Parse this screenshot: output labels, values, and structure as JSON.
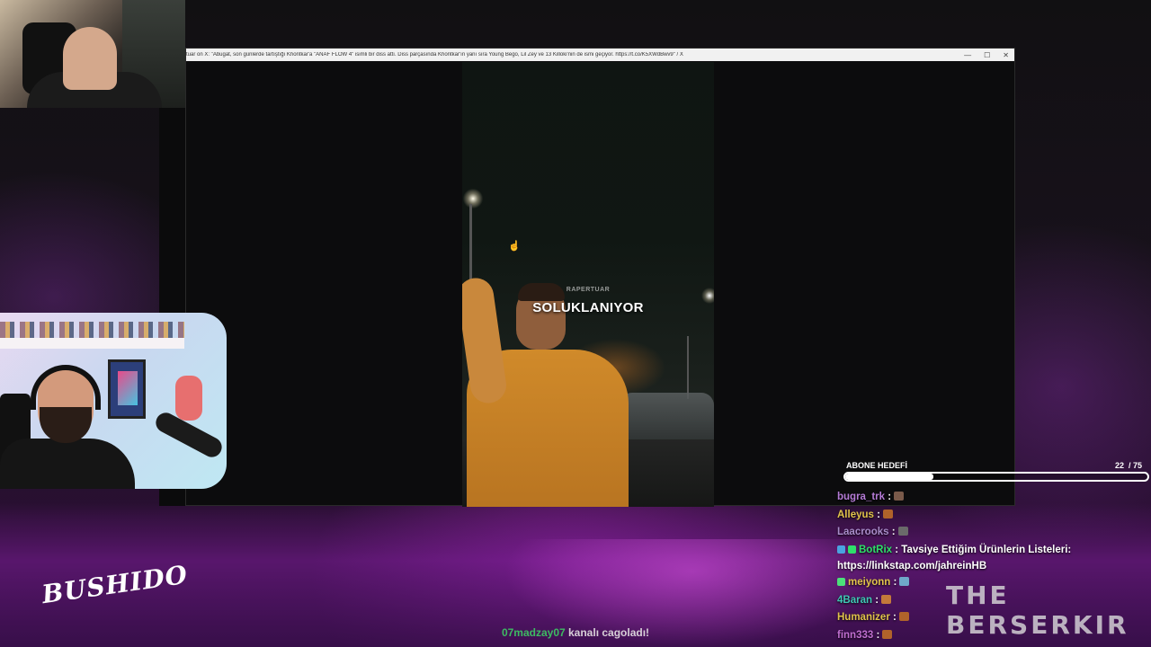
{
  "window": {
    "title": "tuar on X: \"Abugat, son günlerde tartıştığı Khontkar'a \"ANAF FLOW 4\" isimli bir diss attı. Diss parçasında Khontkar'ın yanı sıra Young Bego, Lil Zey ve 13 Killoki'nin de ismi geçiyor. https://t.co/K5XWdBwv9\" / X",
    "minimize": "—",
    "maximize": "☐",
    "close": "✕"
  },
  "video": {
    "watermark": "RAPERTUAR",
    "caption": "SOLUKLANIYOR"
  },
  "logos": {
    "left": "BUSHIDO",
    "right": "THE BERSERKIR"
  },
  "sub_goal": {
    "label": "ABONE HEDEFİ",
    "current": "22",
    "total": "/ 75",
    "progress": 0.293
  },
  "chat": {
    "messages": [
      {
        "user": "bugra_trk",
        "color": "#b57bd6",
        "sep": " :",
        "text": "",
        "emote_color": "#7a5a4a"
      },
      {
        "user": "Alleyus",
        "color": "#e0c34a",
        "sep": " :",
        "text": "",
        "emote_color": "#b0632a"
      },
      {
        "user": "Laacrooks",
        "color": "#a88cc9",
        "sep": " :",
        "text": "",
        "emote_color": "#6a6a6a"
      },
      {
        "user": "BotRix",
        "color": "#2ee06a",
        "sep": " :",
        "text": " Tavsiye Ettiğim Ürünlerin Listeleri:",
        "emote_color": ""
      },
      {
        "user": "meiyonn",
        "color": "#e0c34a",
        "sep": " :",
        "text": "",
        "emote_color": "#6fa8c9"
      },
      {
        "user": "4Baran",
        "color": "#3fc7b5",
        "sep": " :",
        "text": "",
        "emote_color": "#c47a3a"
      },
      {
        "user": "Humanizer",
        "color": "#e0c34a",
        "sep": " :",
        "text": "",
        "emote_color": "#b0632a"
      },
      {
        "user": "finn333",
        "color": "#c06fd0",
        "sep": " :",
        "text": "",
        "emote_color": "#b0632a"
      }
    ],
    "link": "https://linkstap.com/jahreinHB"
  },
  "notification": {
    "nick": "07madzay07",
    "text": " kanalı cagoladı!"
  }
}
